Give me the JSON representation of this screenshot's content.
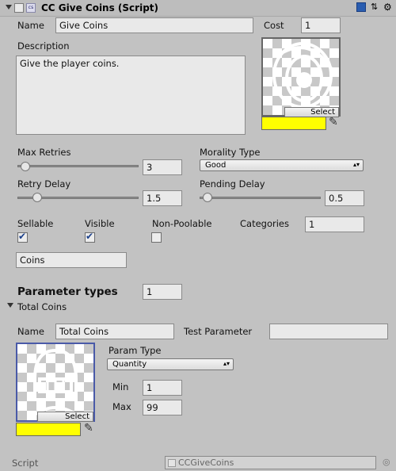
{
  "header": {
    "title": "CC Give Coins (Script)"
  },
  "name": {
    "label": "Name",
    "value": "Give Coins"
  },
  "cost": {
    "label": "Cost",
    "value": "1"
  },
  "description": {
    "label": "Description",
    "value": "Give the player coins."
  },
  "image1": {
    "select_label": "Select",
    "color": "#ffff00"
  },
  "max_retries": {
    "label": "Max Retries",
    "value": "3",
    "slider_fraction": 0.05
  },
  "morality_type": {
    "label": "Morality Type",
    "selected": "Good"
  },
  "retry_delay": {
    "label": "Retry Delay",
    "value": "1.5",
    "slider_fraction": 0.15
  },
  "pending_delay": {
    "label": "Pending Delay",
    "value": "0.5",
    "slider_fraction": 0.05
  },
  "flags": {
    "sellable": {
      "label": "Sellable",
      "checked": true
    },
    "visible": {
      "label": "Visible",
      "checked": true
    },
    "non_poolable": {
      "label": "Non-Poolable",
      "checked": false
    }
  },
  "categories": {
    "label": "Categories",
    "value": "1"
  },
  "category_field": {
    "value": "Coins"
  },
  "parameter_types": {
    "label": "Parameter types",
    "value": "1"
  },
  "total_coins": {
    "foldout_label": "Total Coins",
    "name_label": "Name",
    "name_value": "Total Coins",
    "test_label": "Test Parameter",
    "test_value": "",
    "param_type_label": "Param Type",
    "param_type_selected": "Quantity",
    "min_label": "Min",
    "min_value": "1",
    "max_label": "Max",
    "max_value": "99",
    "select_label": "Select",
    "color": "#ffff00"
  },
  "script": {
    "label": "Script",
    "value": "CCGiveCoins"
  }
}
